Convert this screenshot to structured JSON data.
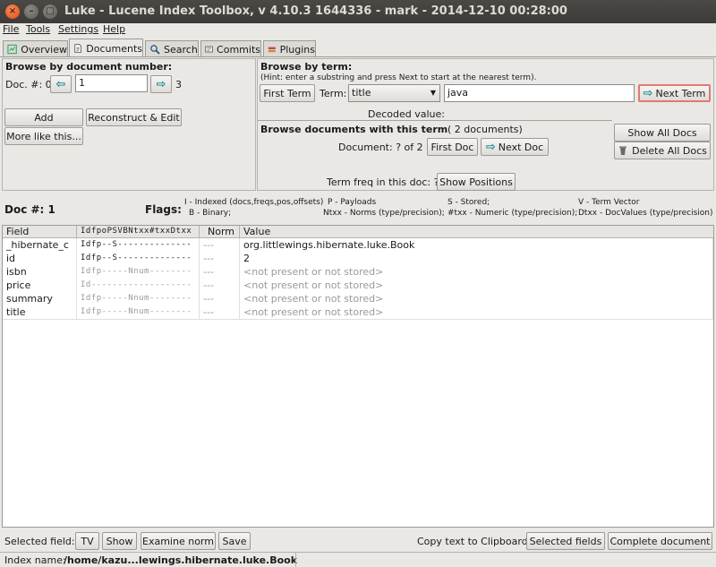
{
  "window": {
    "title": "Luke - Lucene Index Toolbox, v 4.10.3 1644336 - mark - 2014-12-10 00:28:00",
    "close": "×",
    "minimize": "–",
    "maximize": "□"
  },
  "menu": [
    "File",
    "Tools",
    "Settings",
    "Help"
  ],
  "tabs": [
    {
      "label": "Overview",
      "icon": "overview-icon"
    },
    {
      "label": "Documents",
      "icon": "documents-icon"
    },
    {
      "label": "Search",
      "icon": "search-icon"
    },
    {
      "label": "Commits",
      "icon": "commits-icon"
    },
    {
      "label": "Plugins",
      "icon": "plugins-icon"
    }
  ],
  "browse_number": {
    "title": "Browse by document number:",
    "doc_label": "Doc. #: 0",
    "doc_value": "1",
    "max": "3",
    "add": "Add",
    "reconstruct": "Reconstruct & Edit",
    "more_like": "More like this..."
  },
  "browse_term": {
    "title": "Browse by term:",
    "hint": "(Hint: enter a substring and press Next to start at the nearest term).",
    "first_term": "First Term",
    "term_label": "Term:",
    "field_select": "title",
    "term_value": "java",
    "next_term": "Next Term",
    "decoded": "Decoded value:"
  },
  "browse_docs": {
    "title": "Browse documents with this term",
    "count": "( 2 documents)",
    "document_label": "Document: ?  of 2",
    "first_doc": "First Doc",
    "next_doc": "Next Doc",
    "show_all": "Show All Docs",
    "delete_all": "Delete All Docs",
    "term_freq": "Term freq in this doc: ?",
    "show_positions": "Show Positions"
  },
  "doc_info": {
    "doc_num": "Doc #: 1",
    "flags_label": "Flags:",
    "flags": [
      "I - Indexed (docs,freqs,pos,offsets)",
      "P - Payloads",
      "S - Stored;",
      "V - Term Vector",
      "B - Binary;",
      "Ntxx - Norms (type/precision);",
      "#txx - Numeric (type/precision);",
      "Dtxx - DocValues (type/precision)"
    ]
  },
  "table": {
    "headers": [
      "Field",
      "IdfpoPSVBNtxx#txxDtxx",
      "Norm",
      "Value"
    ],
    "rows": [
      {
        "field": "_hibernate_c",
        "flags": "Idfp--S--------------",
        "norm": "---",
        "value": "org.littlewings.hibernate.luke.Book",
        "present": true
      },
      {
        "field": "id",
        "flags": "Idfp--S--------------",
        "norm": "---",
        "value": "2",
        "present": true
      },
      {
        "field": "isbn",
        "flags": "Idfp-----Nnum--------",
        "norm": "---",
        "value": "<not present or not stored>",
        "present": false
      },
      {
        "field": "price",
        "flags": "Id-------------------",
        "norm": "---",
        "value": "<not present or not stored>",
        "present": false
      },
      {
        "field": "summary",
        "flags": "Idfp-----Nnum--------",
        "norm": "---",
        "value": "<not present or not stored>",
        "present": false
      },
      {
        "field": "title",
        "flags": "Idfp-----Nnum--------",
        "norm": "---",
        "value": "<not present or not stored>",
        "present": false
      }
    ]
  },
  "bottom": {
    "selected_field": "Selected field:",
    "tv": "TV",
    "show": "Show",
    "examine_norm": "Examine norm",
    "save": "Save",
    "copy_label": "Copy text to Clipboard:",
    "selected_fields": "Selected fields",
    "complete_document": "Complete document"
  },
  "status": {
    "label": "Index name:",
    "path": "/home/kazu...lewings.hibernate.luke.Book"
  }
}
